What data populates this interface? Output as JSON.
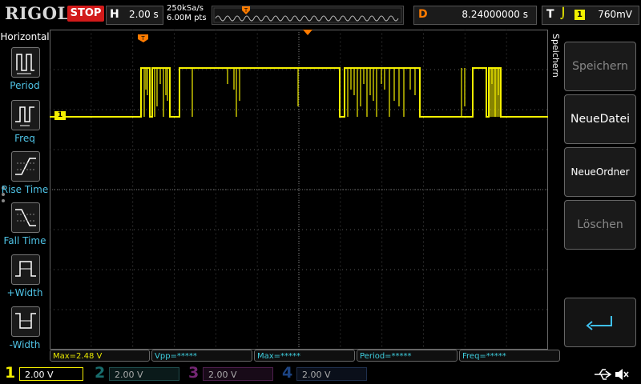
{
  "header": {
    "logo": "RIGOL",
    "run_state": "STOP",
    "horizontal_label": "H",
    "timebase": "2.00 s",
    "sample_rate": "250kSa/s",
    "memory_points": "6.00M pts",
    "delay_label": "D",
    "delay_value": "8.24000000 s",
    "trigger_label": "T",
    "trigger_source": "1",
    "trigger_level": "760mV"
  },
  "left_menu": {
    "title": "Horizontal",
    "items": [
      {
        "label": "Period",
        "icon": "period-icon"
      },
      {
        "label": "Freq",
        "icon": "frequency-icon"
      },
      {
        "label": "Rise Time",
        "icon": "rise-time-icon"
      },
      {
        "label": "Fall Time",
        "icon": "fall-time-icon"
      },
      {
        "label": "+Width",
        "icon": "positive-width-icon"
      },
      {
        "label": "-Width",
        "icon": "negative-width-icon"
      }
    ]
  },
  "right_menu": {
    "title": "Speichern",
    "buttons": [
      {
        "label": "Speichern",
        "enabled": false
      },
      {
        "label": "NeueDatei",
        "enabled": true
      },
      {
        "label": "NeueOrdner",
        "enabled": true
      },
      {
        "label": "Löschen",
        "enabled": false
      }
    ],
    "return_icon": "return-arrow-icon"
  },
  "waveform": {
    "channel_marker": "1",
    "trace_color": "#f5f000"
  },
  "measurements": [
    {
      "text": "Max=2.48 V"
    },
    {
      "text": "Vpp=*****"
    },
    {
      "text": "Max=*****"
    },
    {
      "text": "Period=*****"
    },
    {
      "text": "Freq=*****"
    }
  ],
  "channels": [
    {
      "number": "1",
      "scale": "2.00 V",
      "color": "#f5f000",
      "active": true
    },
    {
      "number": "2",
      "scale": "2.00 V",
      "color": "#28b5b5",
      "active": false
    },
    {
      "number": "3",
      "scale": "2.00 V",
      "color": "#c040c0",
      "active": false
    },
    {
      "number": "4",
      "scale": "2.00 V",
      "color": "#3070d8",
      "active": false
    }
  ],
  "colors": {
    "accent_yellow": "#f5f000",
    "stop_red": "#d21a1a",
    "menu_label_cyan": "#4fc3e6",
    "delay_orange": "#ff7b00"
  }
}
